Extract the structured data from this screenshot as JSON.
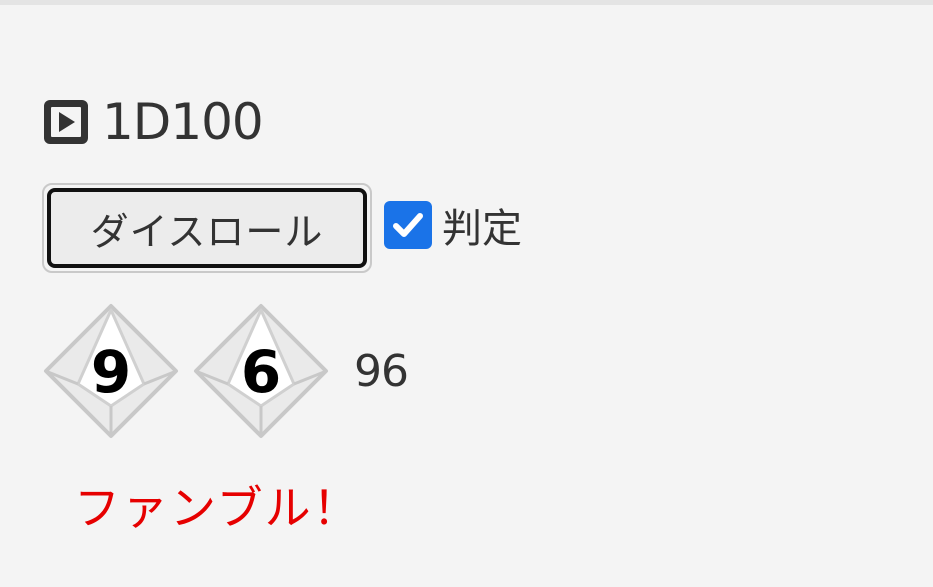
{
  "header": {
    "icon": "play-square-icon",
    "title": "1D100"
  },
  "controls": {
    "roll_button_label": "ダイスロール",
    "judge_label": "判定",
    "judge_checked": true,
    "checkbox_color": "#1a73e8"
  },
  "dice": [
    {
      "icon": "d10-icon",
      "value": "9"
    },
    {
      "icon": "d10-icon",
      "value": "6"
    }
  ],
  "total": "96",
  "result": {
    "text": "ファンブル！",
    "color": "#e60000"
  }
}
